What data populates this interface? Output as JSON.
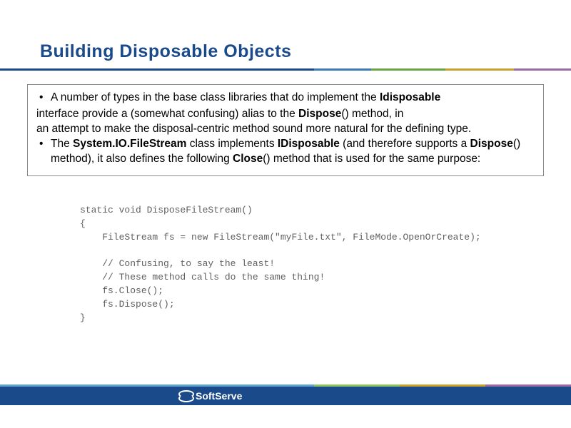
{
  "slide": {
    "title": "Building Disposable Objects",
    "bullets": {
      "b1_pre": "A number of types in the base class libraries that do implement the ",
      "b1_bold": "Idisposable",
      "plain1_pre": "interface provide a (somewhat confusing) alias to the ",
      "plain1_bold": "Dispose",
      "plain1_post": "() method, in",
      "plain2": "an attempt to make the disposal-centric method sound more natural for the defining type.",
      "b2_pre": "The ",
      "b2_bold1": "System.IO.FileStream",
      "b2_mid1": " class implements ",
      "b2_bold2": "IDisposable",
      "b2_mid2": " (and therefore supports a ",
      "b2_bold3": "Dispose",
      "b2_mid3": "() method), it also defines the following ",
      "b2_bold4": "Close",
      "b2_post": "() method that is used for the same purpose:"
    },
    "code": "static void DisposeFileStream()\n{\n    FileStream fs = new FileStream(\"myFile.txt\", FileMode.OpenOrCreate);\n\n    // Confusing, to say the least!\n    // These method calls do the same thing!\n    fs.Close();\n    fs.Dispose();\n}",
    "footer": {
      "brand": "SoftServe"
    }
  }
}
